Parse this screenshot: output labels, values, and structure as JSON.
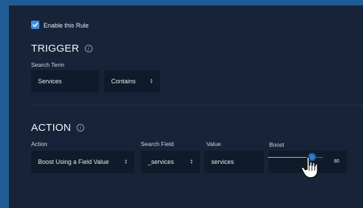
{
  "rule": {
    "enable_label": "Enable this Rule",
    "enabled": true
  },
  "trigger": {
    "title": "TRIGGER",
    "search_term_label": "Search Term",
    "search_term_value": "Services",
    "match_type": "Contains"
  },
  "action": {
    "title": "ACTION",
    "action_label": "Action",
    "action_value": "Boost Using a Field Value",
    "search_field_label": "Search Field",
    "search_field_value": "_services",
    "value_label": "Value",
    "value_value": "services",
    "boost_label": "Boost",
    "boost_value": "80",
    "boost_fraction": 0.8
  },
  "colors": {
    "accent": "#3d8fe0",
    "panel": "#172338",
    "background": "#1f5c93"
  },
  "icons": {
    "checkbox": "checkmark-icon",
    "info": "info-icon",
    "select": "up-down-arrows-icon",
    "cursor": "hand-pointer-icon"
  }
}
